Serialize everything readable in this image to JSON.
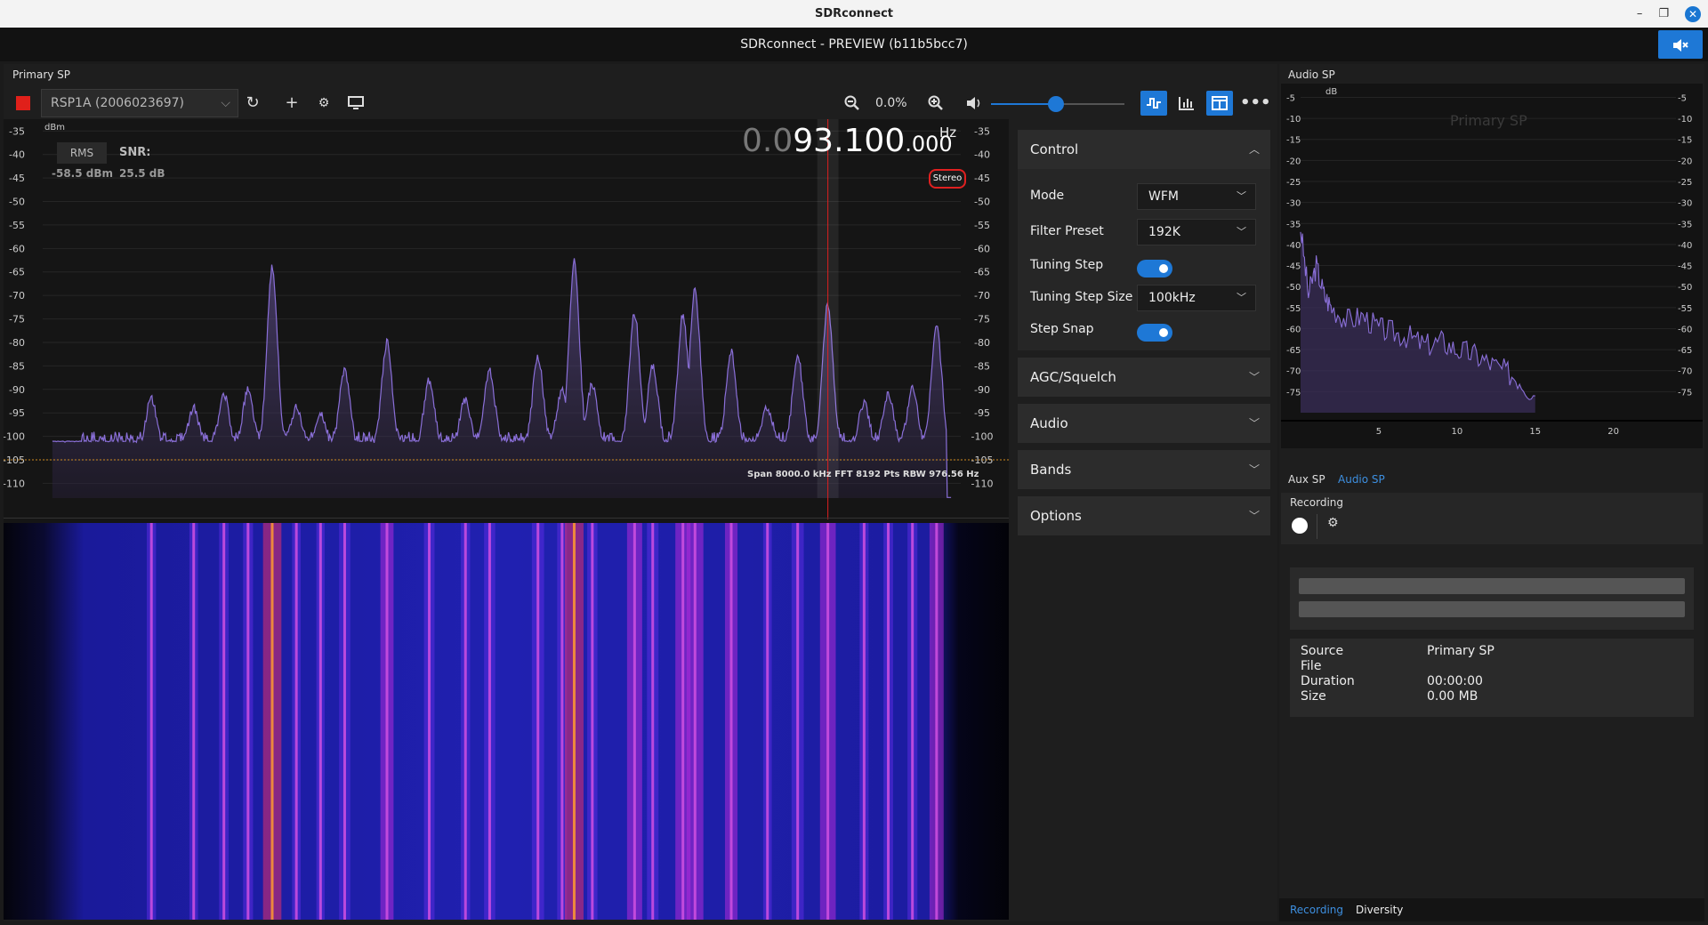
{
  "os_window": {
    "title": "SDRconnect",
    "minimize": "–",
    "restore": "❐",
    "close": "✕"
  },
  "app": {
    "title": "SDRconnect - PREVIEW (b11b5bcc7)",
    "mute_icon": "speaker-mute"
  },
  "primary_sp": {
    "label": "Primary SP",
    "device": "RSP1A (2006023697)",
    "zoom_percent": "0.0%",
    "volume_level": 0.5,
    "frequency_prefix": "0.0",
    "frequency_main": "93.100",
    "frequency_suffix": ".000",
    "frequency_unit": "Hz",
    "stereo_label": "Stereo",
    "unit_label": "dBm",
    "rms_label": "RMS",
    "snr_label": "SNR:",
    "rms_value": "-58.5 dBm",
    "snr_value": "25.5 dB",
    "span_info": "Span 8000.0 kHz FFT 8192 Pts  RBW 976.56 Hz"
  },
  "chart_data": {
    "type": "line",
    "ylabel": "dBm",
    "ylim": [
      -112,
      -34
    ],
    "yticks": [
      -35,
      -40,
      -45,
      -50,
      -55,
      -60,
      -65,
      -70,
      -75,
      -80,
      -85,
      -90,
      -95,
      -100,
      -105,
      -110
    ],
    "xlim": [
      86600,
      94200
    ],
    "xticks": [
      "500",
      "87000",
      "87500",
      "88000",
      "88500",
      "89000",
      "89500",
      "90000",
      "90500",
      "91000",
      "91500",
      "92000",
      "92500",
      "93000",
      "93500",
      "94000"
    ],
    "xtick_values": [
      86500,
      87000,
      87500,
      88000,
      88500,
      89000,
      89500,
      90000,
      90500,
      91000,
      91500,
      92000,
      92500,
      93000,
      93500,
      94000
    ],
    "noise_floor": -105,
    "tuned_freq": 93100,
    "peaks": [
      {
        "f": 87500,
        "db": -93
      },
      {
        "f": 87850,
        "db": -95
      },
      {
        "f": 88100,
        "db": -92
      },
      {
        "f": 88300,
        "db": -91
      },
      {
        "f": 88500,
        "db": -65
      },
      {
        "f": 88700,
        "db": -95
      },
      {
        "f": 88900,
        "db": -96
      },
      {
        "f": 89100,
        "db": -87
      },
      {
        "f": 89450,
        "db": -81
      },
      {
        "f": 89800,
        "db": -89
      },
      {
        "f": 90100,
        "db": -93
      },
      {
        "f": 90300,
        "db": -87
      },
      {
        "f": 90700,
        "db": -84
      },
      {
        "f": 90900,
        "db": -91
      },
      {
        "f": 91000,
        "db": -64
      },
      {
        "f": 91150,
        "db": -90
      },
      {
        "f": 91500,
        "db": -75
      },
      {
        "f": 91650,
        "db": -86
      },
      {
        "f": 91900,
        "db": -75
      },
      {
        "f": 92000,
        "db": -70
      },
      {
        "f": 92300,
        "db": -83
      },
      {
        "f": 92600,
        "db": -95
      },
      {
        "f": 92850,
        "db": -84
      },
      {
        "f": 93100,
        "db": -73
      },
      {
        "f": 93400,
        "db": -94
      },
      {
        "f": 93600,
        "db": -92
      },
      {
        "f": 93800,
        "db": -91
      },
      {
        "f": 94000,
        "db": -78
      }
    ]
  },
  "control": {
    "title": "Control",
    "mode_label": "Mode",
    "mode_value": "WFM",
    "filter_label": "Filter Preset",
    "filter_value": "192K",
    "tuning_step_label": "Tuning Step",
    "tuning_step_on": true,
    "step_size_label": "Tuning Step Size",
    "step_size_value": "100kHz",
    "step_snap_label": "Step Snap",
    "step_snap_on": true,
    "sections": [
      "AGC/Squelch",
      "Audio",
      "Bands",
      "Options"
    ]
  },
  "audio_sp": {
    "label": "Audio SP",
    "watermark": "Primary SP",
    "unit": "dB",
    "yticks": [
      "-5",
      "-10",
      "-15",
      "-20",
      "-25",
      "-30",
      "-35",
      "-40",
      "-45",
      "-50",
      "-55",
      "-60",
      "-65",
      "-70",
      "-75"
    ],
    "xticks": [
      "5",
      "10",
      "15",
      "20"
    ],
    "chart_data": {
      "type": "line",
      "x_unit": "kHz",
      "xlim": [
        0,
        24
      ],
      "ylim": [
        -80,
        -3
      ],
      "x": [
        0,
        0.5,
        1,
        1.5,
        2,
        3,
        4,
        5,
        6,
        7,
        8,
        9,
        10,
        11,
        12,
        13,
        14,
        15
      ],
      "y": [
        -36,
        -52,
        -45,
        -52,
        -55,
        -58,
        -57,
        -60,
        -61,
        -62,
        -64,
        -63,
        -65,
        -66,
        -68,
        -70,
        -72,
        -76
      ]
    }
  },
  "right_tabs": {
    "aux": "Aux SP",
    "audio": "Audio SP"
  },
  "recording": {
    "label": "Recording",
    "source_key": "Source",
    "source_val": "Primary SP",
    "file_key": "File",
    "file_val": "",
    "duration_key": "Duration",
    "duration_val": "00:00:00",
    "size_key": "Size",
    "size_val": "0.00 MB"
  },
  "bottom_tabs": {
    "recording": "Recording",
    "diversity": "Diversity"
  },
  "colors": {
    "accent": "#1e78d6",
    "spectrum_line": "#8a6fd8",
    "tuned_line": "#e02020",
    "noise_line": "#d08a20"
  }
}
